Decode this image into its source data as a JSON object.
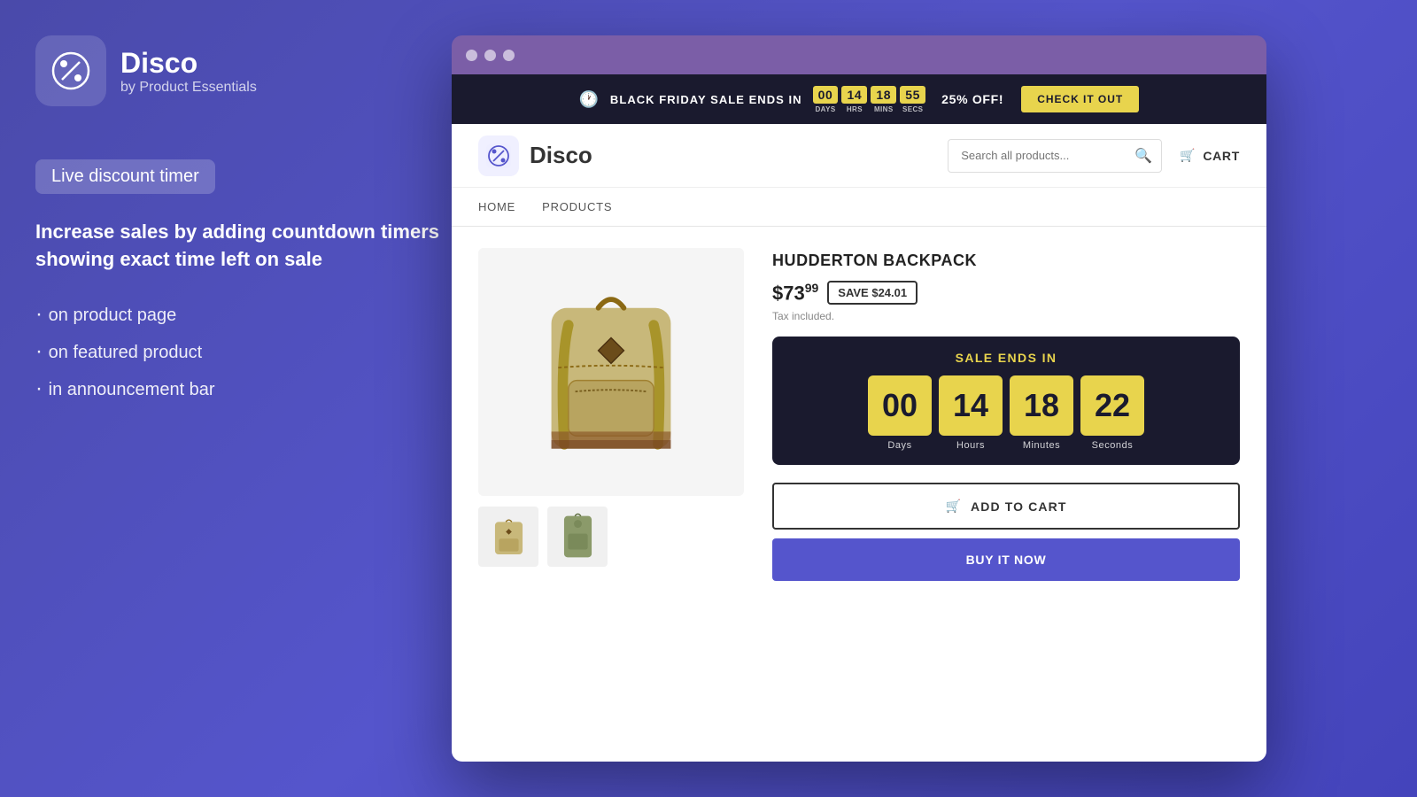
{
  "app": {
    "name": "Disco",
    "subtitle": "by Product Essentials",
    "icon": "%"
  },
  "left_panel": {
    "badge": "Live discount timer",
    "description": "Increase sales by adding countdown timers showing exact time left on sale",
    "features": [
      "on product page",
      "on featured product",
      "in announcement bar"
    ]
  },
  "announcement_bar": {
    "sale_text": "BLACK FRIDAY SALE ENDS IN",
    "countdown": {
      "days": "00",
      "hours": "14",
      "minutes": "18",
      "seconds": "55",
      "days_label": "DAYS",
      "hours_label": "HRS",
      "minutes_label": "MINS",
      "seconds_label": "SECS"
    },
    "discount_text": "25% OFF!",
    "cta_label": "CHECK IT OUT"
  },
  "store": {
    "name": "Disco",
    "search_placeholder": "Search all products...",
    "cart_label": "CART",
    "nav": [
      {
        "label": "HOME"
      },
      {
        "label": "PRODUCTS"
      }
    ]
  },
  "product": {
    "name": "HUDDERTON BACKPACK",
    "price": "$73",
    "price_cents": "99",
    "save_label": "SAVE $24.01",
    "tax_note": "Tax included.",
    "sale_ends_label": "SALE ENDS IN",
    "countdown": {
      "days": "00",
      "hours": "14",
      "minutes": "18",
      "seconds": "22",
      "days_label": "Days",
      "hours_label": "Hours",
      "minutes_label": "Minutes",
      "seconds_label": "Seconds"
    },
    "add_to_cart": "ADD TO CART",
    "buy_now": "BUY IT NOW"
  },
  "colors": {
    "brand_purple": "#5555cc",
    "yellow": "#e8d44d",
    "dark_bg": "#1a1a2e",
    "browser_chrome": "#7b5ea7"
  }
}
